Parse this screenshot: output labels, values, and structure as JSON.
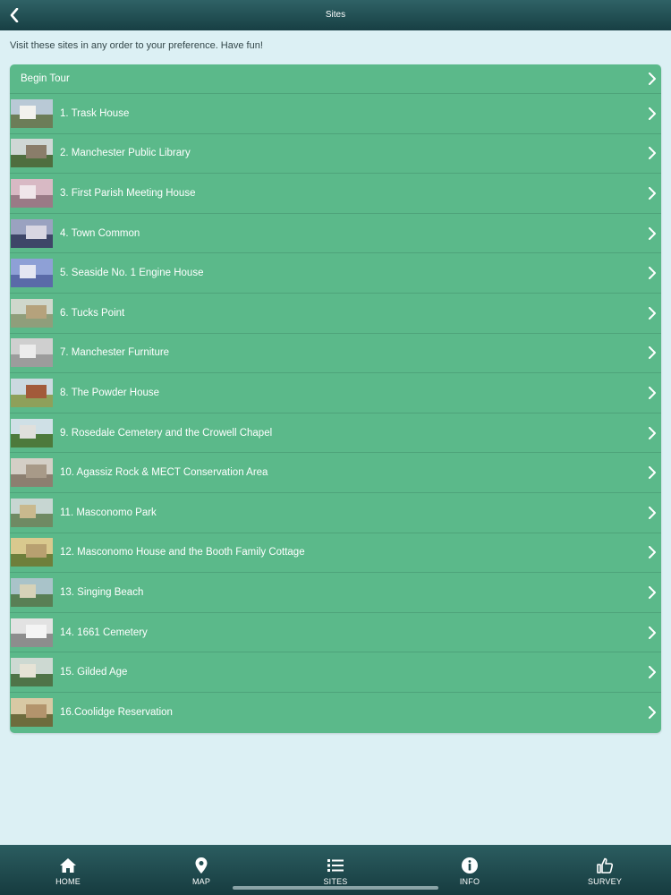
{
  "header": {
    "title": "Sites",
    "back_icon": "chevron-left-icon"
  },
  "intro": "Visit these sites in any order to your preference. Have fun!",
  "begin_tour": "Begin Tour",
  "sites": [
    {
      "label": "1. Trask House",
      "sky": "#b9c9d6",
      "ground": "#6c7d58",
      "bld": "#f2f2ee"
    },
    {
      "label": "2. Manchester Public Library",
      "sky": "#cfd7d5",
      "ground": "#4f6e3f",
      "bld": "#8a7d6a"
    },
    {
      "label": "3. First Parish Meeting House",
      "sky": "#d8b9c4",
      "ground": "#9a7a86",
      "bld": "#f0e6ea"
    },
    {
      "label": "4. Town Common",
      "sky": "#9aa2c0",
      "ground": "#3e4668",
      "bld": "#d8d6e2"
    },
    {
      "label": "5. Seaside No. 1 Engine House",
      "sky": "#8ea0d6",
      "ground": "#5a6aa8",
      "bld": "#e4e6f2"
    },
    {
      "label": "6. Tucks Point",
      "sky": "#cfd7cc",
      "ground": "#8f9e7b",
      "bld": "#b5a27c"
    },
    {
      "label": "7. Manchester Furniture",
      "sky": "#cfcfcf",
      "ground": "#9c9c9c",
      "bld": "#ececec"
    },
    {
      "label": "8. The Powder House",
      "sky": "#cbd9e0",
      "ground": "#8ea05a",
      "bld": "#a25a3a"
    },
    {
      "label": "9. Rosedale Cemetery and the Crowell Chapel",
      "sky": "#cfe0e6",
      "ground": "#4d7a3c",
      "bld": "#e0e0dc"
    },
    {
      "label": "10. Agassiz Rock & MECT Conservation Area",
      "sky": "#d4cfc6",
      "ground": "#8c7f70",
      "bld": "#a89a88"
    },
    {
      "label": "11. Masconomo Park",
      "sky": "#c7d6d2",
      "ground": "#6f8a63",
      "bld": "#c9b98e"
    },
    {
      "label": "12. Masconomo House and the Booth Family Cottage",
      "sky": "#d9c98e",
      "ground": "#6e7f3b",
      "bld": "#b8a070"
    },
    {
      "label": "13. Singing Beach",
      "sky": "#a9c3c9",
      "ground": "#597f55",
      "bld": "#d6d2b8"
    },
    {
      "label": "14. 1661 Cemetery",
      "sky": "#e2e2e2",
      "ground": "#8d8d8d",
      "bld": "#f4f4f4"
    },
    {
      "label": "15. Gilded Age",
      "sky": "#cdd9d2",
      "ground": "#4f7448",
      "bld": "#e6e3d6"
    },
    {
      "label": "16.Coolidge Reservation",
      "sky": "#d8c9a4",
      "ground": "#6d6c3d",
      "bld": "#b3946c"
    }
  ],
  "tabs": [
    {
      "label": "HOME",
      "icon": "home-icon"
    },
    {
      "label": "MAP",
      "icon": "map-pin-icon"
    },
    {
      "label": "SITES",
      "icon": "list-icon"
    },
    {
      "label": "INFO",
      "icon": "info-icon"
    },
    {
      "label": "SURVEY",
      "icon": "thumbs-up-icon"
    }
  ]
}
